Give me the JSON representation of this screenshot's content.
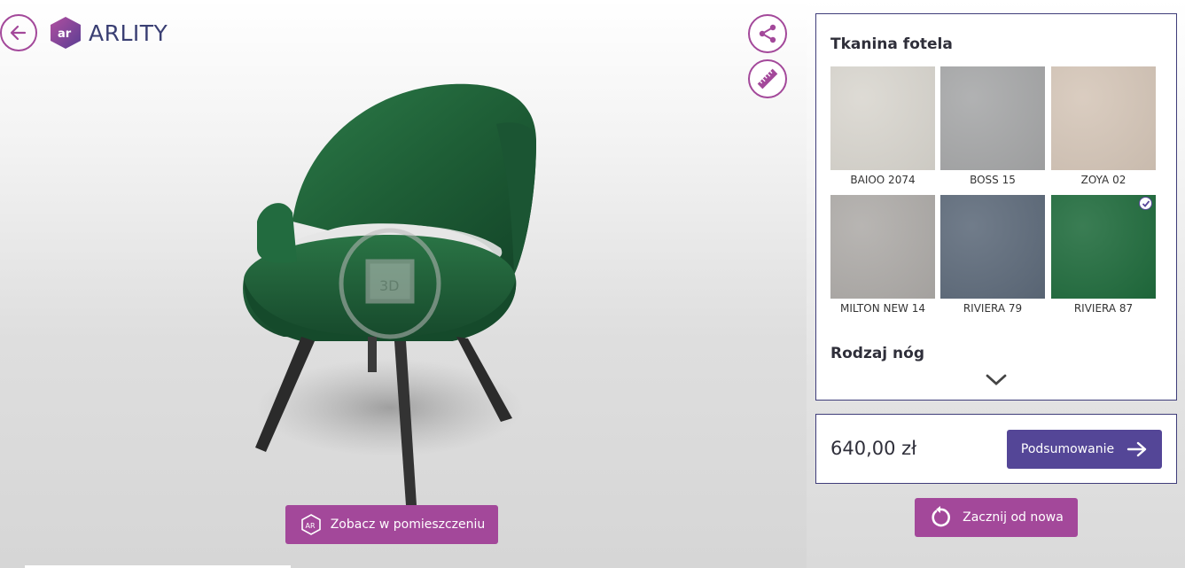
{
  "app": {
    "brand": "ARLITY",
    "back_label": "",
    "share_icon": "share-icon",
    "measure_icon": "ruler-icon"
  },
  "viewer": {
    "rotate_badge": "3D",
    "ar_button_label": "Zobacz w pomieszczeniu",
    "ar_icon_text": "AR"
  },
  "config": {
    "fabric_title": "Tkanina fotela",
    "legs_title": "Rodzaj nóg",
    "fabrics": [
      {
        "name": "BAIOO 2074",
        "color": "#d9d6cf",
        "selected": false
      },
      {
        "name": "BOSS 15",
        "color": "#a6a7a8",
        "selected": false
      },
      {
        "name": "ZOYA 02",
        "color": "#d5c6b8",
        "selected": false
      },
      {
        "name": "MILTON NEW 14",
        "color": "#aeaba8",
        "selected": false
      },
      {
        "name": "RIVIERA 79",
        "color": "#5d6a7a",
        "selected": false
      },
      {
        "name": "RIVIERA 87",
        "color": "#1f6b3c",
        "selected": true
      }
    ]
  },
  "summary": {
    "price": "640,00 zł",
    "summary_button": "Podsumowanie",
    "restart_button": "Zacznij od nowa"
  },
  "colors": {
    "accent": "#a3489a",
    "primary": "#544697",
    "border": "#3f3d7a",
    "chair_green": "#1f5e38"
  }
}
